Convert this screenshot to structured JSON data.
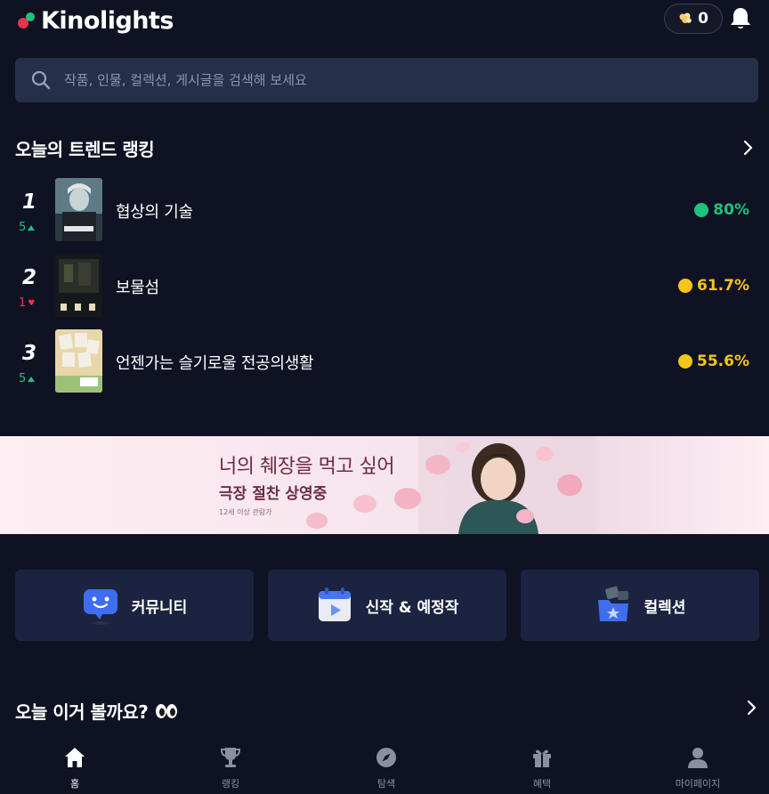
{
  "header": {
    "logo_text": "Kinolights",
    "points": "0"
  },
  "search": {
    "placeholder": "작품, 인물, 컬렉션, 게시글을 검색해 보세요"
  },
  "trend": {
    "title": "오늘의 트렌드 랭킹",
    "items": [
      {
        "rank": "1",
        "change": "5",
        "direction": "up",
        "title": "협상의 기술",
        "score": "80%",
        "score_color": "#1ec27e"
      },
      {
        "rank": "2",
        "change": "1",
        "direction": "down",
        "title": "보물섬",
        "score": "61.7%",
        "score_color": "#f5c518"
      },
      {
        "rank": "3",
        "change": "5",
        "direction": "up",
        "title": "언젠가는 슬기로울 전공의생활",
        "score": "55.6%",
        "score_color": "#f5c518"
      }
    ]
  },
  "banner": {
    "title": "너의 췌장을 먹고 싶어",
    "subtitle": "극장 절찬 상영중",
    "rating": "12세 이상 관람가"
  },
  "menu": [
    {
      "label": "커뮤니티",
      "icon": "community-chat-icon"
    },
    {
      "label": "신작 & 예정작",
      "icon": "calendar-play-icon"
    },
    {
      "label": "컬렉션",
      "icon": "collection-folder-icon"
    }
  ],
  "recommend": {
    "title": "오늘 이거 볼까요?"
  },
  "nav": [
    {
      "label": "홈",
      "icon": "home-icon",
      "active": true
    },
    {
      "label": "랭킹",
      "icon": "trophy-icon",
      "active": false
    },
    {
      "label": "탐색",
      "icon": "compass-icon",
      "active": false
    },
    {
      "label": "혜택",
      "icon": "gift-icon",
      "active": false
    },
    {
      "label": "마이페이지",
      "icon": "person-icon",
      "active": false
    }
  ],
  "colors": {
    "background": "#0f1222",
    "search_bg": "#252f4a",
    "card_bg": "#1b2340",
    "green": "#1ec27e",
    "yellow": "#f5c518",
    "red": "#e8344d"
  }
}
